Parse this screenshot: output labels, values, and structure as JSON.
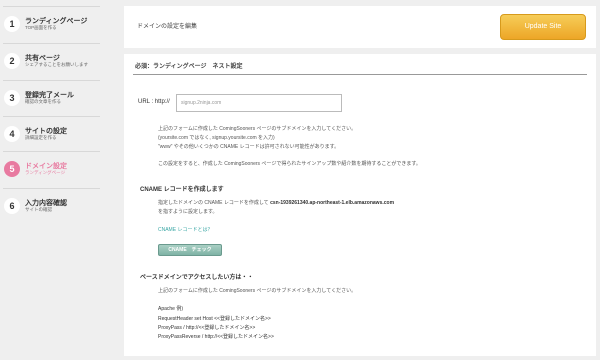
{
  "sidebar": {
    "steps": [
      {
        "num": "1",
        "title": "ランディングページ",
        "sub": "TOP画面を作る",
        "active": false
      },
      {
        "num": "2",
        "title": "共有ページ",
        "sub": "シェアすることをお願いします",
        "active": false
      },
      {
        "num": "3",
        "title": "登録完了メール",
        "sub": "確認の文章を作る",
        "active": false
      },
      {
        "num": "4",
        "title": "サイトの設定",
        "sub": "詳細設定を作る",
        "active": false
      },
      {
        "num": "5",
        "title": "ドメイン設定",
        "sub": "ランディングページ",
        "active": true
      },
      {
        "num": "6",
        "title": "入力内容確認",
        "sub": "サイトの確認",
        "active": false
      }
    ],
    "active_color": "#e87aa0"
  },
  "topbar": {
    "title": "ドメインの設定を編集",
    "update_label": "Update Site"
  },
  "panel": {
    "heading": "必須：ランディングページ　ネスト設定",
    "url_label": "URL : http://",
    "url_placeholder": "signup.2ninja.com",
    "help_line1": "上記のフォームに作成した ComingSooners ページのサブドメインを入力してください。",
    "help_line2": "(yoursite.com ではなく, signup.yoursite.com を入力)",
    "help_line3": "\"www\" やその他いくつかの CNAME レコードは許可されない可能性があります。",
    "help_line4": "この設定をすると、作成した ComingSooners ページで得られたサインアップ数や紹介数を期待することができます。",
    "cname_heading": "CNAME レコードを作成します",
    "cname_line1_prefix": "指定したドメインの CNAME レコードを作成して",
    "cname_value": "csn-1939261340.ap-northeast-1.elb.amazonaws.com",
    "cname_line2": "を指すように設定します。",
    "cname_link": "CNAME レコードとは？",
    "cname_check_label": "CNAME　チェック",
    "base_heading": "ベースドメインでアクセスしたい方は・・",
    "base_line1": "上記のフォームに作成した ComingSooners ページのサブドメインを入力してください。",
    "apache_label": "Apache 例)",
    "apache_line1": "RequestHeader set Host <<登録したドメイン名>>",
    "apache_line2": "ProxyPass / http://<<登録したドメイン名>>",
    "apache_line3": "ProxyPassReverse / http://<<登録したドメイン名>>"
  },
  "colors": {
    "accent_orange": "#eda627",
    "accent_teal": "#3aa7a5",
    "active_pink": "#e87aa0"
  }
}
